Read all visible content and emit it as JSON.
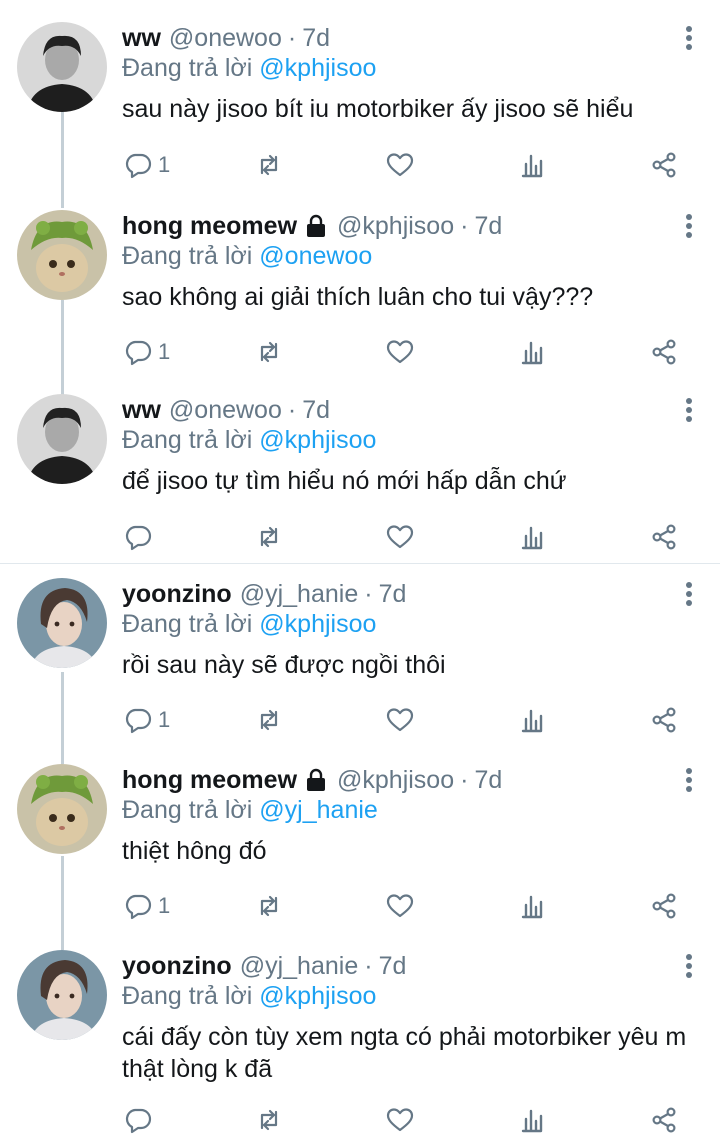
{
  "replying_prefix": "Đang trả lời",
  "tweets": [
    {
      "name": "ww",
      "handle": "@onewoo",
      "sep": "·",
      "time": "7d",
      "locked": false,
      "reply_to": "@kphjisoo",
      "text": "sau này jisoo bít iu motorbiker ấy jisoo sẽ hiểu",
      "reply_count": "1"
    },
    {
      "name": "hong meomew",
      "handle": "@kphjisoo",
      "sep": "·",
      "time": "7d",
      "locked": true,
      "reply_to": "@onewoo",
      "text": "sao không ai giải thích luân cho tui vậy???",
      "reply_count": "1"
    },
    {
      "name": "ww",
      "handle": "@onewoo",
      "sep": "·",
      "time": "7d",
      "locked": false,
      "reply_to": "@kphjisoo",
      "text": "để jisoo tự tìm hiểu nó mới hấp dẫn chứ",
      "reply_count": ""
    },
    {
      "name": "yoonzino",
      "handle": "@yj_hanie",
      "sep": "·",
      "time": "7d",
      "locked": false,
      "reply_to": "@kphjisoo",
      "text": "rồi sau này sẽ được ngồi thôi",
      "reply_count": "1"
    },
    {
      "name": "hong meomew",
      "handle": "@kphjisoo",
      "sep": "·",
      "time": "7d",
      "locked": true,
      "reply_to": "@yj_hanie",
      "text": "thiệt hông đó",
      "reply_count": "1"
    },
    {
      "name": "yoonzino",
      "handle": "@yj_hanie",
      "sep": "·",
      "time": "7d",
      "locked": false,
      "reply_to": "@kphjisoo",
      "text": "cái đấy còn tùy xem ngta có phải motorbiker yêu m thật lòng k đã",
      "reply_count": ""
    }
  ],
  "icons": {
    "reply": "reply-icon",
    "retweet": "retweet-icon",
    "like": "heart-icon",
    "stats": "analytics-icon",
    "share": "share-icon",
    "more": "more-vertical-icon",
    "lock": "lock-icon"
  },
  "colors": {
    "mention": "#1da1f2",
    "secondary_text": "#657786",
    "primary_text": "#14171a",
    "thread_line": "#c4cfd6",
    "divider": "#e1e8ed"
  }
}
